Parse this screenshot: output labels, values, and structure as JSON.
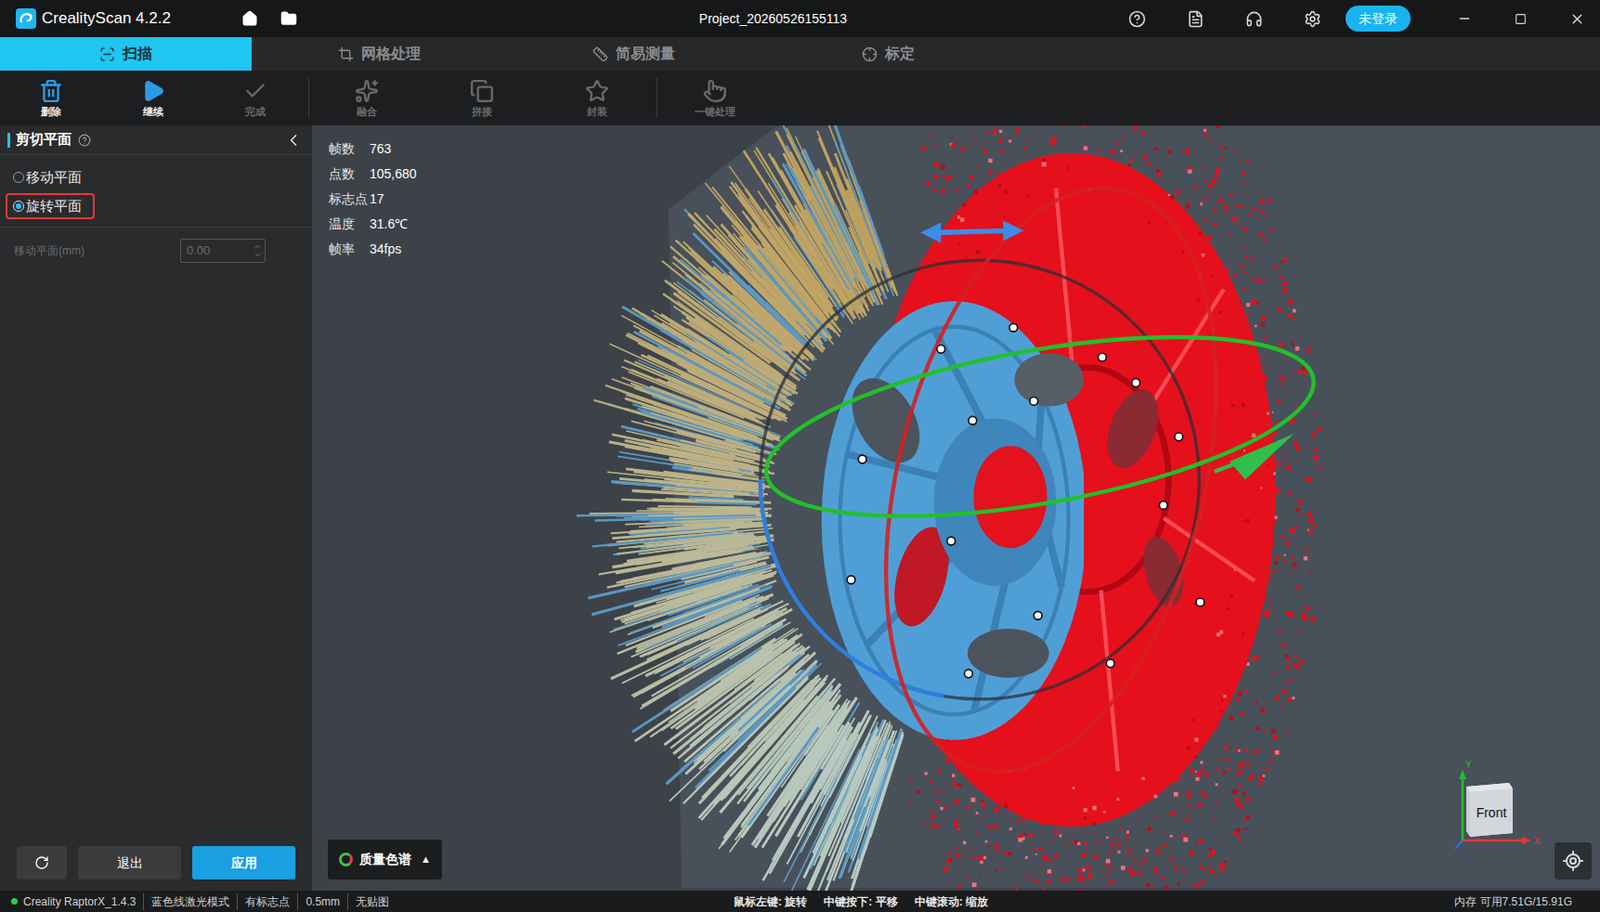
{
  "window": {
    "title": "CrealityScan 4.2.2",
    "project": "Project_20260526155113",
    "login": "未登录"
  },
  "tabs": [
    {
      "label": "扫描",
      "selected": true
    },
    {
      "label": "网格处理",
      "selected": false
    },
    {
      "label": "简易测量",
      "selected": false
    },
    {
      "label": "标定",
      "selected": false
    }
  ],
  "toolbar_groups": [
    [
      {
        "label": "删除",
        "disabled": false
      },
      {
        "label": "继续",
        "disabled": false
      },
      {
        "label": "完成",
        "disabled": true
      }
    ],
    [
      {
        "label": "融合",
        "disabled": true
      },
      {
        "label": "拼接",
        "disabled": true
      },
      {
        "label": "封装",
        "disabled": true
      }
    ],
    [
      {
        "label": "一键处理",
        "disabled": true
      }
    ]
  ],
  "panel": {
    "title": "剪切平面",
    "options": [
      {
        "label": "移动平面",
        "selected": false,
        "highlighted": false
      },
      {
        "label": "旋转平面",
        "selected": true,
        "highlighted": true
      }
    ],
    "field": {
      "label": "移动平面(mm)",
      "value": "0.00",
      "disabled": true
    },
    "buttons": [
      {
        "label": "退出",
        "primary": false
      },
      {
        "label": "应用",
        "primary": true
      }
    ]
  },
  "stats": [
    {
      "label": "帧数",
      "value": "763"
    },
    {
      "label": "点数",
      "value": "105,680"
    },
    {
      "label": "标志点",
      "value": "17"
    },
    {
      "label": "温度",
      "value": "31.6℃"
    },
    {
      "label": "帧率",
      "value": "34fps"
    }
  ],
  "quality_button": {
    "label": "质量色谱",
    "arrow": "▲"
  },
  "view_cube": {
    "face": "Front",
    "axes": [
      "Y",
      "X"
    ]
  },
  "status_bar": {
    "connected": true,
    "items": [
      "Creality RaptorX_1.4.3",
      "蓝色线激光模式",
      "有标志点",
      "0.5mm",
      "无贴图"
    ],
    "hints": [
      "鼠标左键: 旋转",
      "中键按下: 平移",
      "中键滚动: 缩放"
    ],
    "memory": "内存 可用7.51G/15.91G"
  }
}
